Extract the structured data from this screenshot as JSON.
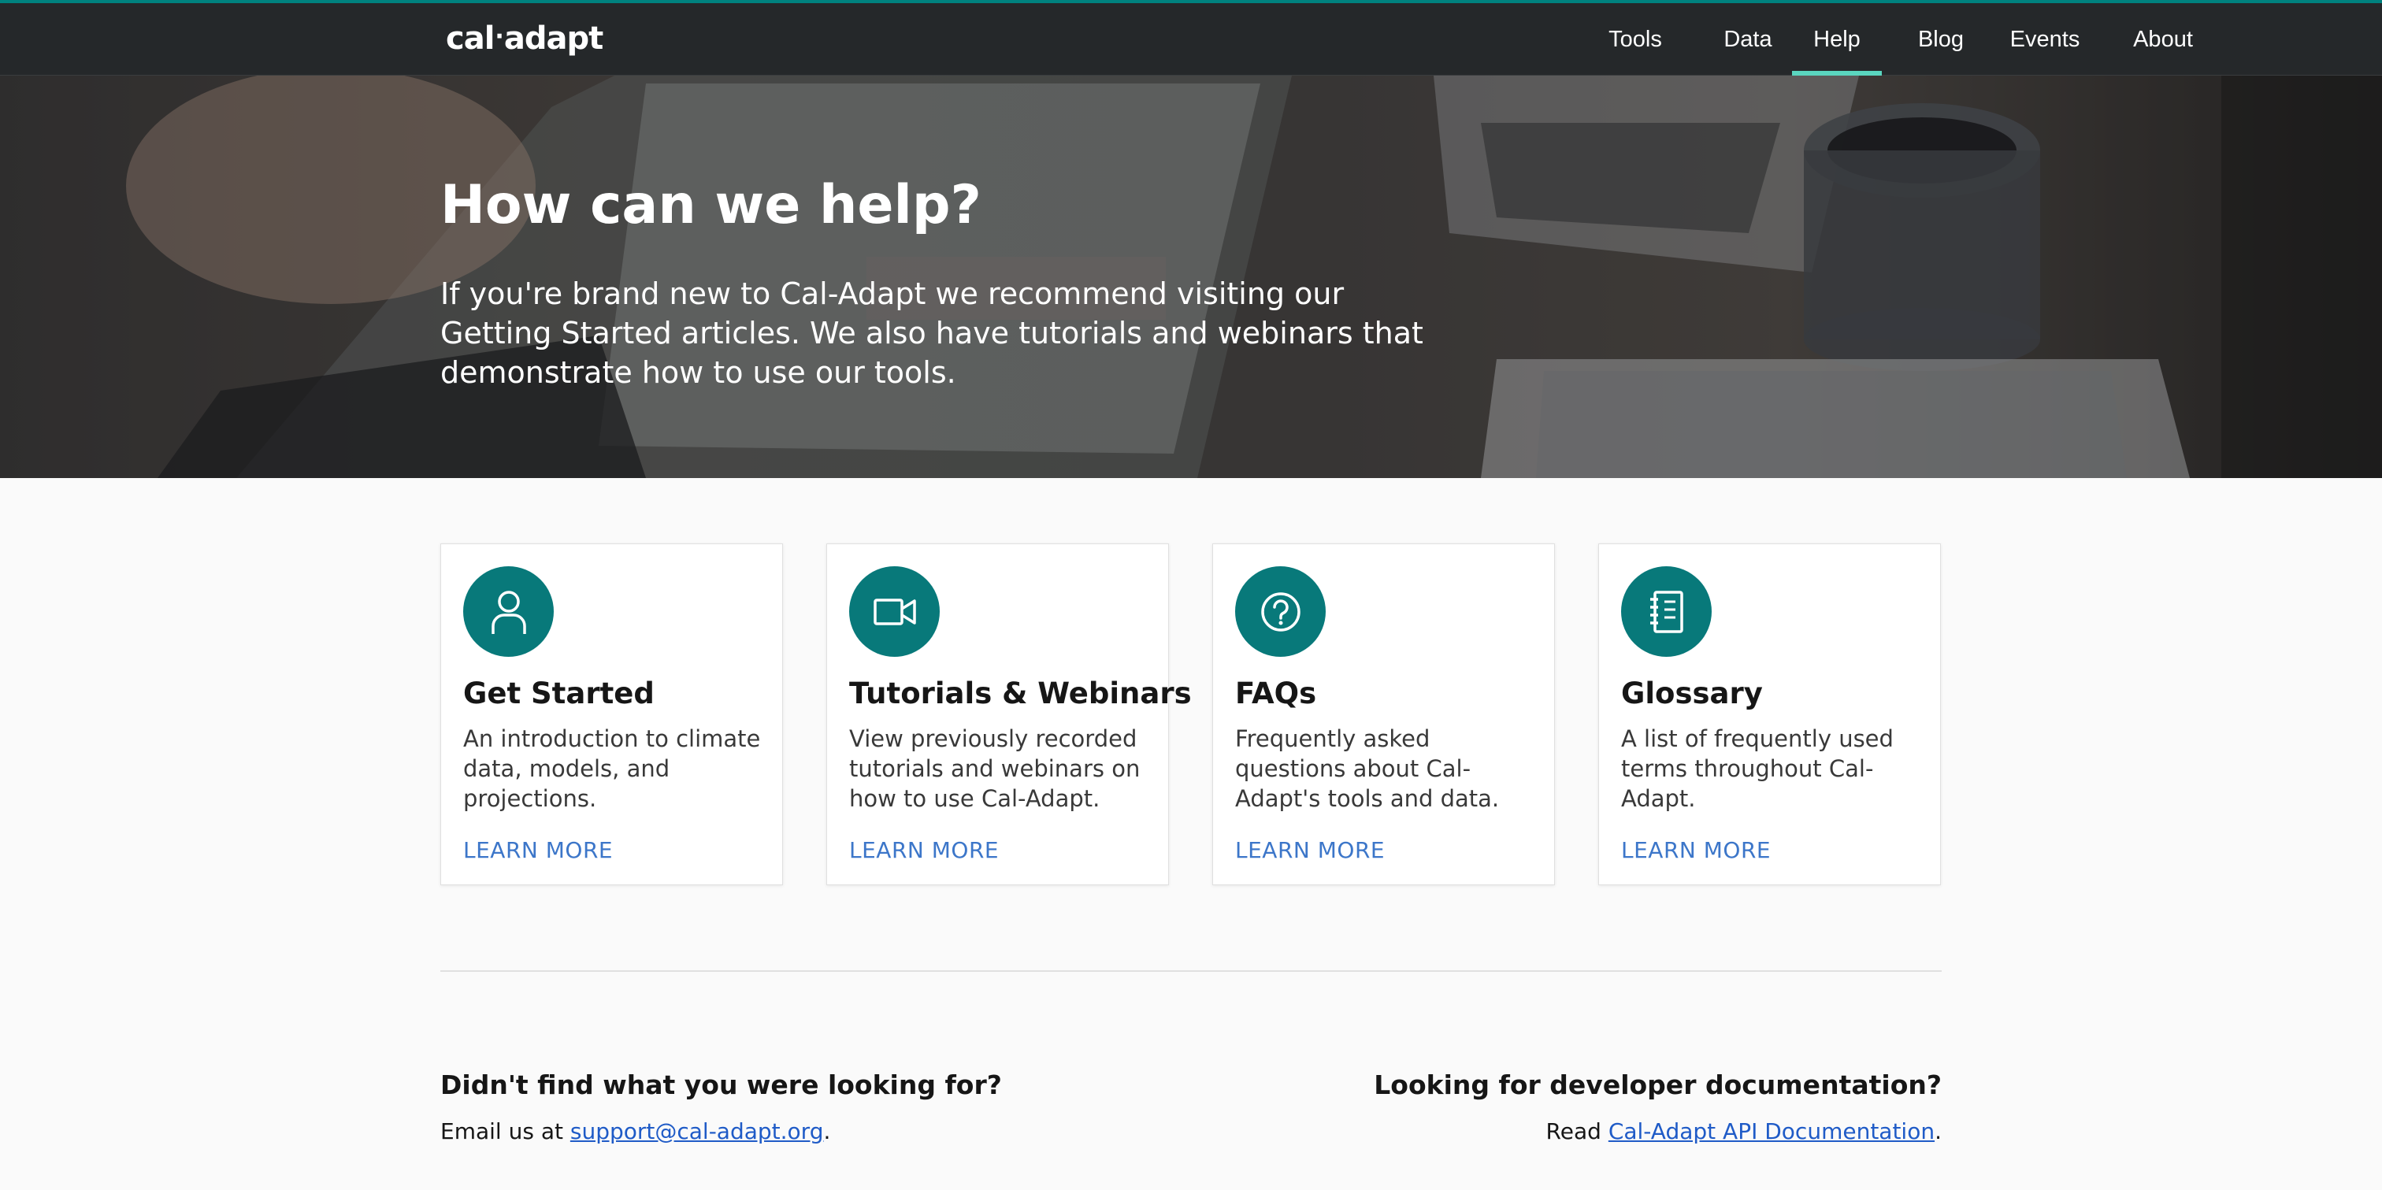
{
  "brand": {
    "logo_left": "cal",
    "logo_dot": "·",
    "logo_right": "adapt",
    "accent": "#00827f",
    "nav_underline": "#5ad6bf"
  },
  "nav": {
    "items": [
      {
        "label": "Tools"
      },
      {
        "label": "Data"
      },
      {
        "label": "Help",
        "active": true
      },
      {
        "label": "Blog"
      },
      {
        "label": "Events"
      },
      {
        "label": "About"
      }
    ]
  },
  "hero": {
    "title": "How can we help?",
    "subtitle": "If you're brand new to Cal-Adapt we recommend visiting our Getting Started articles. We also have tutorials and webinars that demonstrate how to use our tools."
  },
  "cards": [
    {
      "icon": "person-icon",
      "title": "Get Started",
      "description": "An introduction to climate data, models, and projections.",
      "link": "LEARN MORE"
    },
    {
      "icon": "video-camera-icon",
      "title": "Tutorials & Webinars",
      "description": "View previously recorded tutorials and webinars on how to use Cal-Adapt.",
      "link": "LEARN MORE"
    },
    {
      "icon": "question-circle-icon",
      "title": "FAQs",
      "description": "Frequently asked questions about Cal-Adapt's tools and data.",
      "link": "LEARN MORE"
    },
    {
      "icon": "notebook-icon",
      "title": "Glossary",
      "description": "A list of frequently used terms throughout Cal-Adapt.",
      "link": "LEARN MORE"
    }
  ],
  "help": {
    "left_title": "Didn't find what you were looking for?",
    "left_prefix": "Email us at ",
    "left_link": "support@cal-adapt.org",
    "left_suffix": ".",
    "right_title": "Looking for developer documentation?",
    "right_prefix": "Read ",
    "right_link": "Cal-Adapt API Documentation",
    "right_suffix": "."
  },
  "colors": {
    "icon_circle": "#08797a",
    "link": "#3c76c9",
    "topbar": "#25282a"
  }
}
